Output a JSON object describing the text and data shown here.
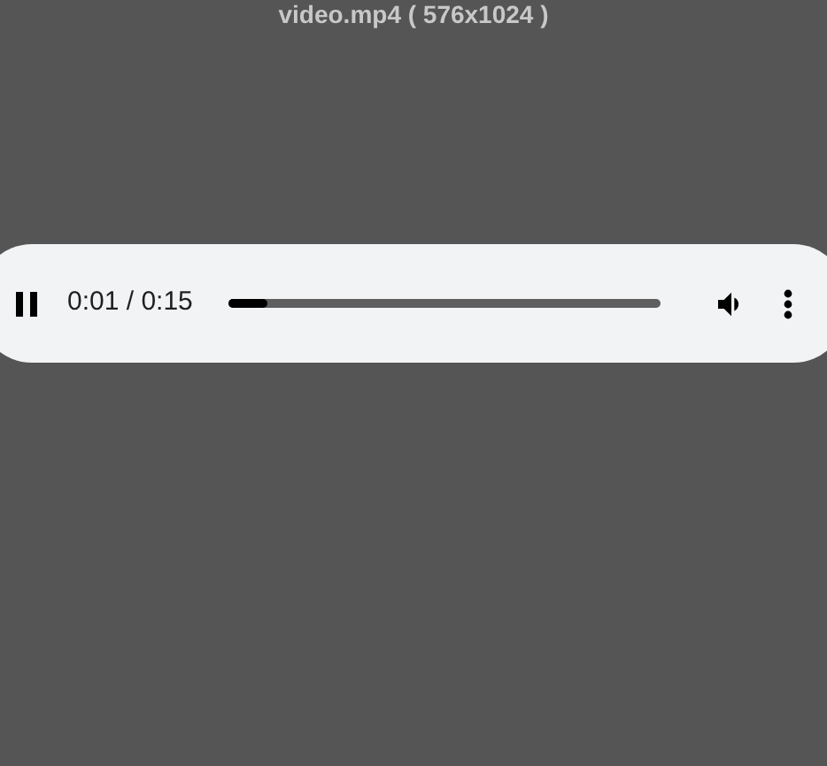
{
  "title": "video.mp4 ( 576x1024 )",
  "player": {
    "playing": true,
    "time": "0:01 / 0:15",
    "level": 0.09,
    "muted": false
  }
}
